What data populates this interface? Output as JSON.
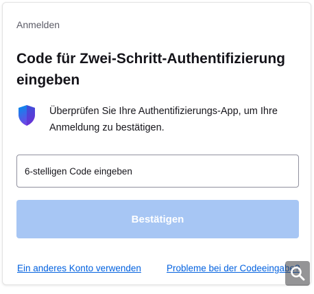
{
  "header": {
    "label": "Anmelden"
  },
  "title": "Code für Zwei-Schritt-Authentifizierung eingeben",
  "info": {
    "text": "Überprüfen Sie Ihre Authentifizierungs-App, um Ihre Anmeldung zu bestätigen.",
    "icon": "shield-icon"
  },
  "code_input": {
    "placeholder": "6-stelligen Code eingeben",
    "value": ""
  },
  "confirm_button": {
    "label": "Bestätigen",
    "state": "disabled"
  },
  "links": {
    "other_account": "Ein anderes Konto verwenden",
    "code_problems": "Probleme bei der Codeeingabe?"
  },
  "overlay": {
    "icon": "magnifier-icon"
  },
  "colors": {
    "primary_disabled": "#a7c6f4",
    "link": "#0060df",
    "shield_top": "#0090ed",
    "shield_bottom": "#7542e5"
  }
}
